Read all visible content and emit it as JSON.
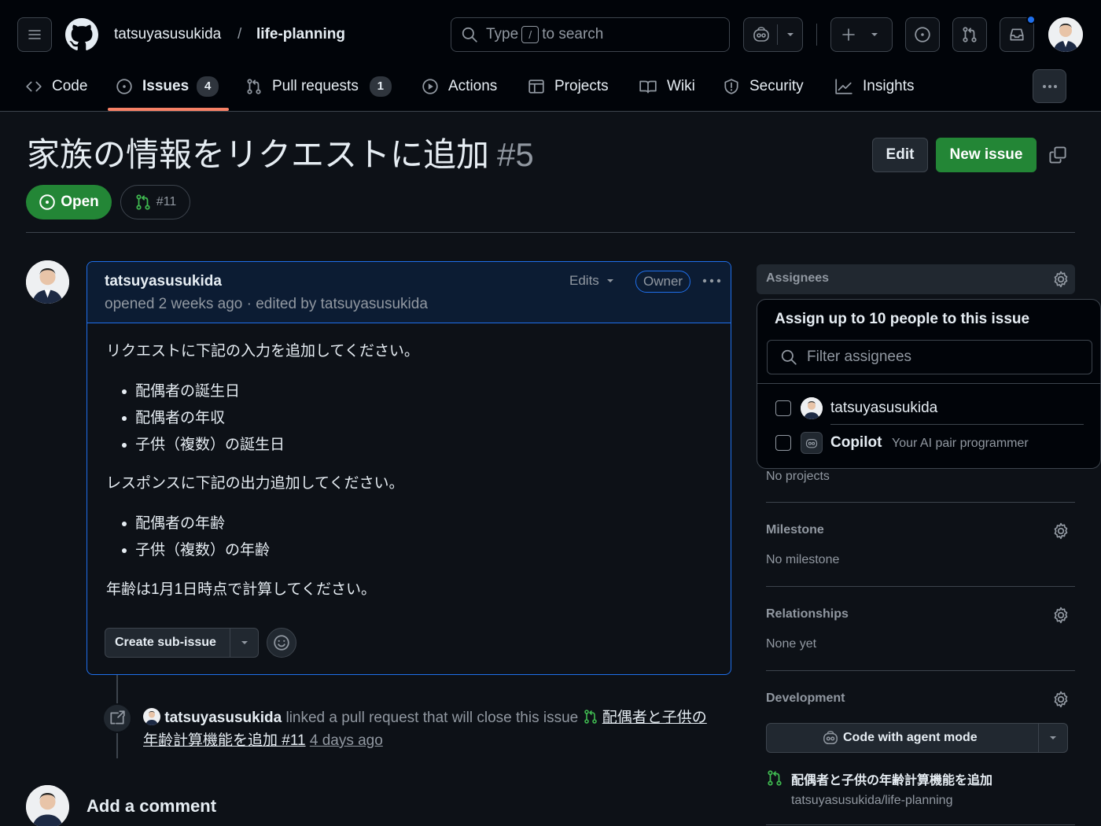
{
  "header": {
    "owner": "tatsuyasusukida",
    "separator": "/",
    "repo": "life-planning",
    "search_prefix": "Type",
    "search_key": "/",
    "search_suffix": "to search"
  },
  "tabs": [
    {
      "label": "Code"
    },
    {
      "label": "Issues",
      "count": "4"
    },
    {
      "label": "Pull requests",
      "count": "1"
    },
    {
      "label": "Actions"
    },
    {
      "label": "Projects"
    },
    {
      "label": "Wiki"
    },
    {
      "label": "Security"
    },
    {
      "label": "Insights"
    }
  ],
  "issue": {
    "title": "家族の情報をリクエストに追加",
    "number": "#5",
    "state": "Open",
    "linked_pr": "#11",
    "edit_label": "Edit",
    "new_issue_label": "New issue"
  },
  "comment": {
    "author": "tatsuyasusukida",
    "meta": "opened 2 weeks ago · edited by tatsuyasusukida",
    "edits_label": "Edits",
    "role_badge": "Owner",
    "intro1": "リクエストに下記の入力を追加してください。",
    "list1": [
      "配偶者の誕生日",
      "配偶者の年収",
      "子供（複数）の誕生日"
    ],
    "intro2": "レスポンスに下記の出力追加してください。",
    "list2": [
      "配偶者の年齢",
      "子供（複数）の年齢"
    ],
    "note": "年齢は1月1日時点で計算してください。",
    "sub_issue_label": "Create sub-issue"
  },
  "timeline": {
    "actor": "tatsuyasusukida",
    "action": "linked a pull request that will close this issue",
    "pr_title": "配偶者と子供の年齢計算機能を追加 #11",
    "time": "4 days ago"
  },
  "add_comment": "Add a comment",
  "sidebar": {
    "assignees_heading": "Assignees",
    "projects_value": "No projects",
    "milestone_heading": "Milestone",
    "milestone_value": "No milestone",
    "relationships_heading": "Relationships",
    "relationships_value": "None yet",
    "development_heading": "Development",
    "agent_button": "Code with agent mode",
    "dev_pr_title": "配偶者と子供の年齢計算機能を追加",
    "dev_pr_repo": "tatsuyasusukida/life-planning"
  },
  "assignee_popover": {
    "title": "Assign up to 10 people to this issue",
    "filter_placeholder": "Filter assignees",
    "options": [
      {
        "name": "tatsuyasusukida",
        "desc": ""
      },
      {
        "name": "Copilot",
        "desc": "Your AI pair programmer"
      }
    ]
  },
  "colors": {
    "accent_green": "#238636",
    "accent_blue": "#1f6feb",
    "notification_dot": "#1f6feb",
    "active_tab_underline": "#f78166"
  }
}
